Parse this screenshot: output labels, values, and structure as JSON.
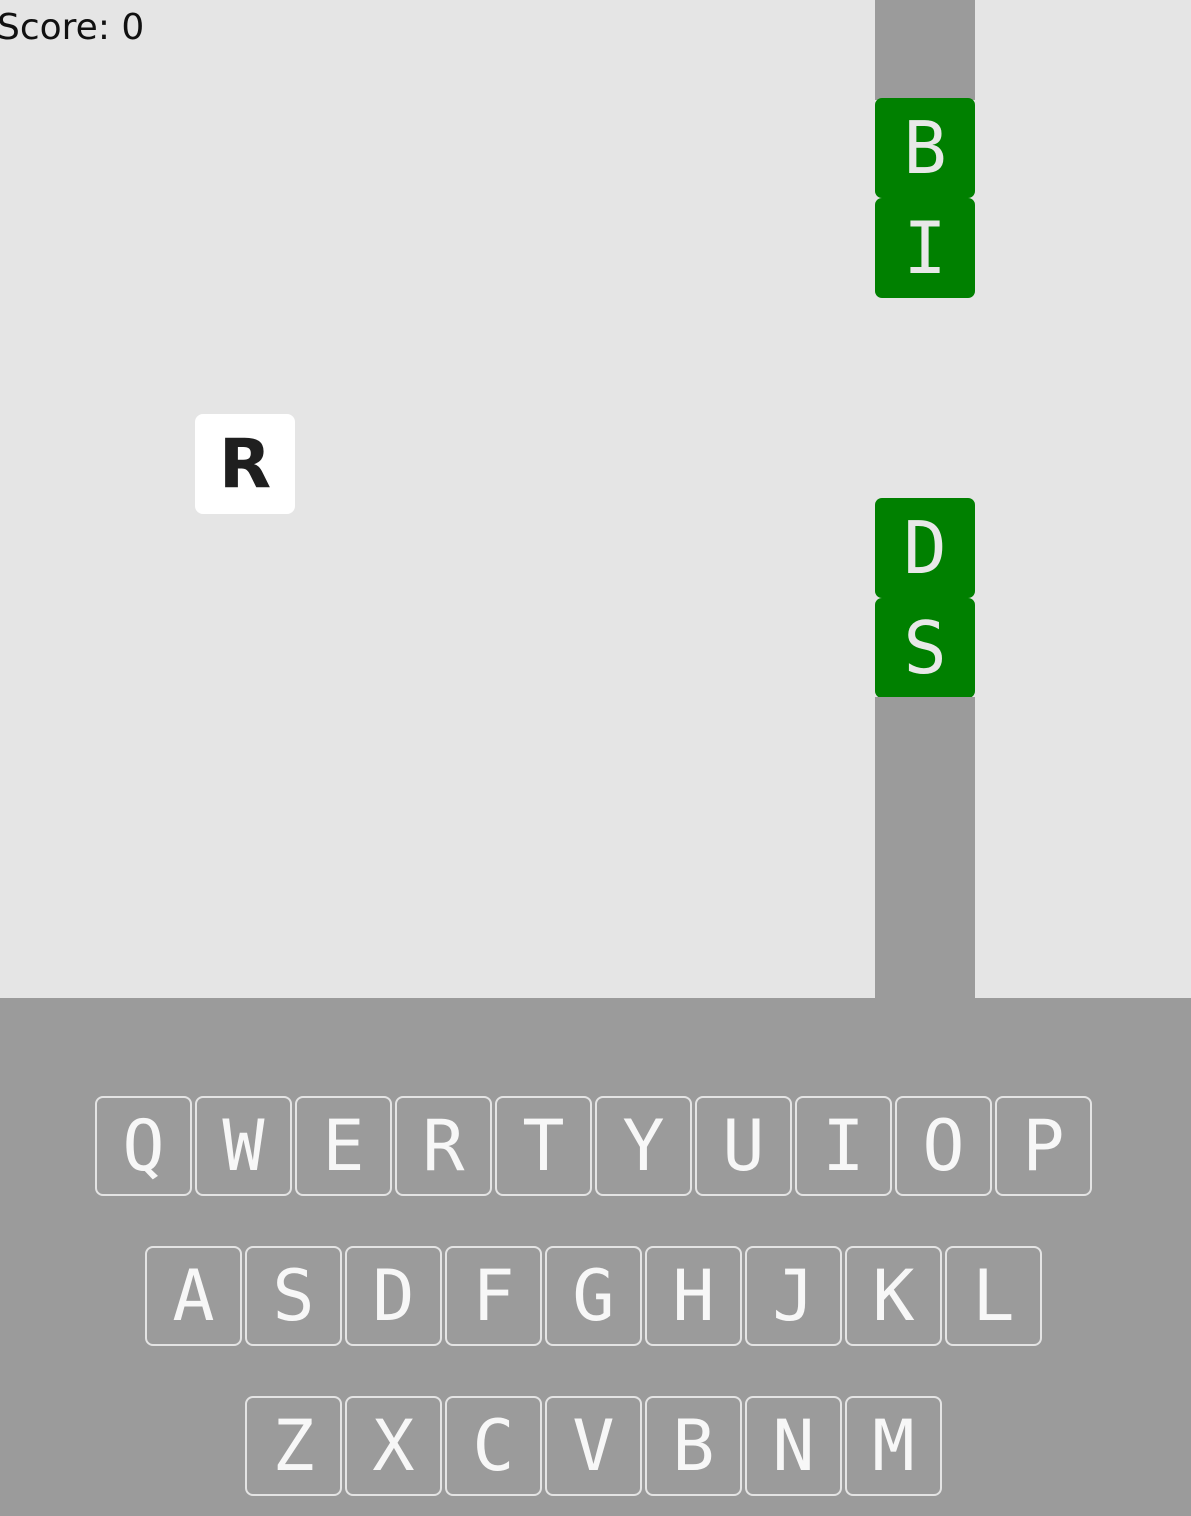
{
  "score": {
    "label": "Score:",
    "value": "0"
  },
  "player_letter": "R",
  "blocks": [
    "B",
    "I",
    "D",
    "S"
  ],
  "keyboard": {
    "rows": [
      [
        "Q",
        "W",
        "E",
        "R",
        "T",
        "Y",
        "U",
        "I",
        "O",
        "P"
      ],
      [
        "A",
        "S",
        "D",
        "F",
        "G",
        "H",
        "J",
        "K",
        "L"
      ],
      [
        "Z",
        "X",
        "C",
        "V",
        "B",
        "N",
        "M"
      ]
    ]
  },
  "colors": {
    "background": "#e5e5e5",
    "pipe": "#9b9b9b",
    "block": "#008000",
    "player": "#ffffff",
    "keyboard": "#9b9b9b"
  }
}
